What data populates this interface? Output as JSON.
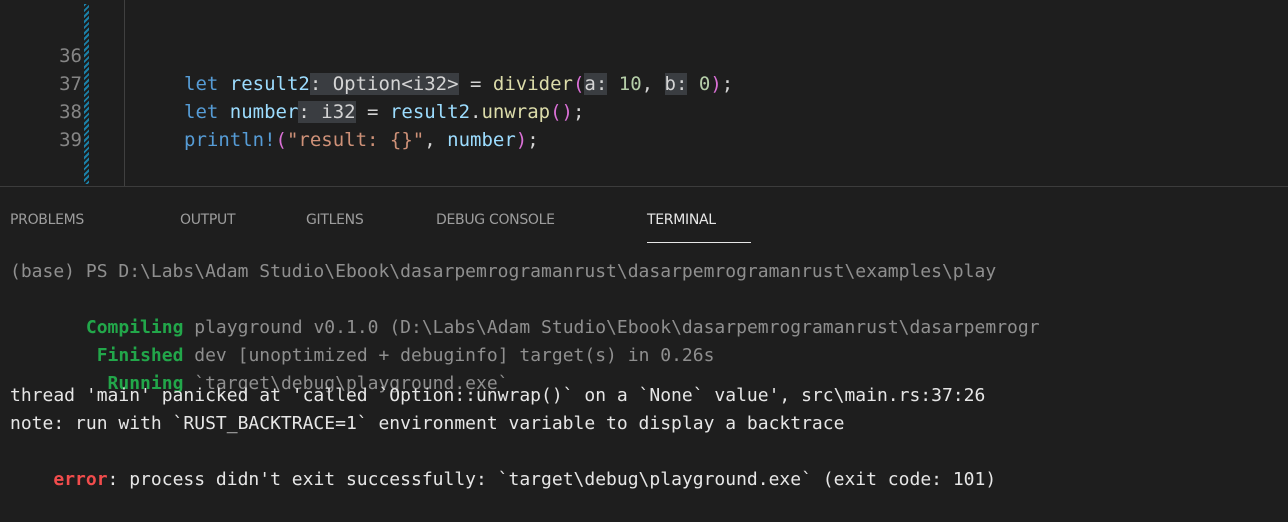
{
  "editor": {
    "lines": [
      {
        "num": "36"
      },
      {
        "num": "37"
      },
      {
        "num": "38"
      },
      {
        "num": "39"
      }
    ],
    "l36": {
      "kw": "let ",
      "var": "result2",
      "hint": ": Option<i32>",
      "eq": " = ",
      "fn": "divider",
      "lp": "(",
      "ha": "a:",
      "sp1": " ",
      "n1": "10",
      "comma": ", ",
      "hb": "b:",
      "sp2": " ",
      "n2": "0",
      "rp": ")",
      "semi": ";"
    },
    "l37": {
      "kw": "let ",
      "var": "number",
      "hint": ": i32",
      "eq": " = ",
      "var2": "result2",
      "dot": ".",
      "fn": "unwrap",
      "parens": "()",
      "semi": ";"
    },
    "l38": {
      "fn": "println!",
      "lp": "(",
      "str": "\"result: {}\"",
      "comma": ", ",
      "var": "number",
      "rp": ")",
      "semi": ";"
    }
  },
  "panel": {
    "tabs": [
      {
        "label": "PROBLEMS"
      },
      {
        "label": "OUTPUT"
      },
      {
        "label": "GITLENS"
      },
      {
        "label": "DEBUG CONSOLE"
      },
      {
        "label": "TERMINAL"
      }
    ]
  },
  "terminal": {
    "prompt": "(base) PS D:\\Labs\\Adam Studio\\Ebook\\dasarpemrogramanrust\\dasarpemrogramanrust\\examples\\play",
    "compiling_kw": "Compiling",
    "compiling_rest": " playground v0.1.0 (D:\\Labs\\Adam Studio\\Ebook\\dasarpemrogramanrust\\dasarpemrogr",
    "finished_kw": "Finished",
    "finished_rest": " dev [unoptimized + debuginfo] target(s) in 0.26s",
    "running_kw": "Running",
    "running_rest": " `target\\debug\\playground.exe`",
    "panic": "thread 'main' panicked at 'called `Option::unwrap()` on a `None` value', src\\main.rs:37:26",
    "note": "note: run with `RUST_BACKTRACE=1` environment variable to display a backtrace",
    "error_kw": "error",
    "error_rest": ": process didn't exit successfully: `target\\debug\\playground.exe` (exit code: 101)"
  }
}
